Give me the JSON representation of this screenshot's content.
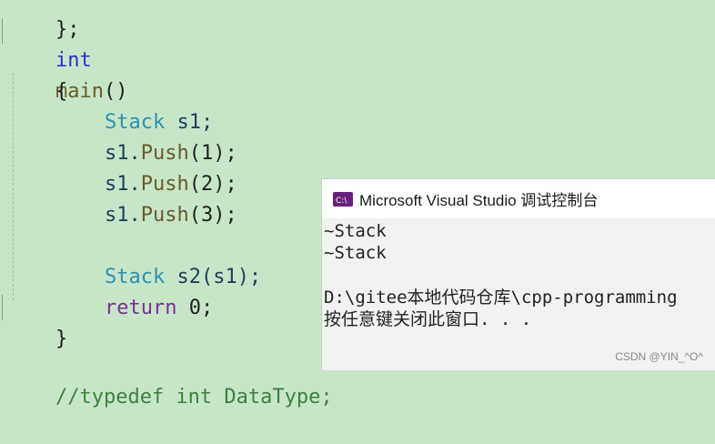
{
  "editor": {
    "line_prev_close": "};",
    "line_main": {
      "kw": "int",
      "fn": "main",
      "tail": "()"
    },
    "line_open": "{",
    "line_stack_s1": {
      "type": "Stack",
      "rest": " s1;"
    },
    "line_push1": {
      "var": "s1.",
      "fn": "Push",
      "rest": "(1);"
    },
    "line_push2": {
      "var": "s1.",
      "fn": "Push",
      "rest": "(2);"
    },
    "line_push3": {
      "var": "s1.",
      "fn": "Push",
      "rest": "(3);"
    },
    "line_stack_s2": {
      "type": "Stack",
      "rest": " s2(s1);"
    },
    "line_return": {
      "kw": "return",
      "rest": " 0;"
    },
    "line_close": "}",
    "line_typedef": {
      "comment": "//typedef int DataType;"
    }
  },
  "console": {
    "title": "Microsoft Visual Studio 调试控制台",
    "icon": "vs-debug-console-icon",
    "output_lines": [
      "~Stack",
      "~Stack",
      "",
      "D:\\gitee本地代码仓库\\cpp-programming",
      "按任意键关闭此窗口. . ."
    ]
  },
  "watermark": "CSDN @YIN_^O^",
  "colors": {
    "editor_bg": "#c7e6c8",
    "keyword": "#2d2ecf",
    "return_keyword": "#7a2e96",
    "type": "#2b91af",
    "function": "#6b5a2a",
    "console_bg": "#f2f2f2",
    "vs_purple": "#68217a"
  }
}
